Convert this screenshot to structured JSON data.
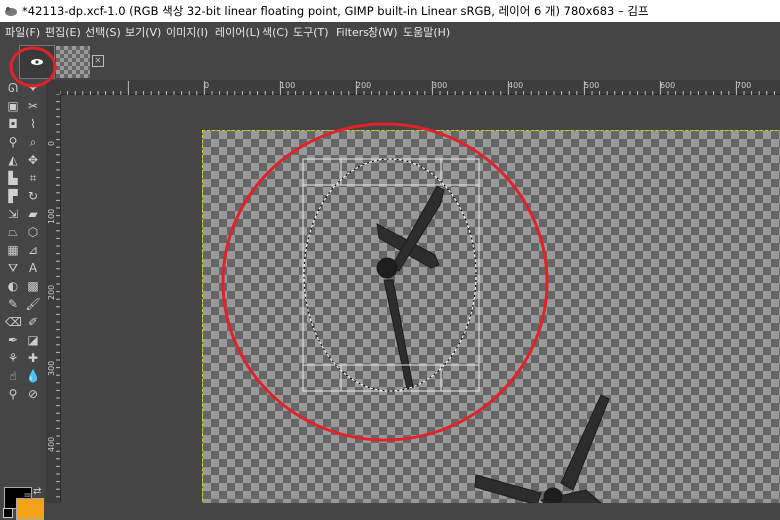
{
  "window": {
    "title": "*42113-dp.xcf-1.0 (RGB 색상 32-bit linear floating point, GIMP built-in Linear sRGB, 레이어 6 개) 780x683 – 김프"
  },
  "menu": {
    "items": [
      "파일(F)",
      "편집(E)",
      "선택(S)",
      "보기(V)",
      "이미지(I)",
      "레이어(L)",
      "색(C)",
      "도구(T)",
      "Filters",
      "창(W)",
      "도움말(H)"
    ]
  },
  "rulers": {
    "top_labels": [
      "0",
      "100",
      "200",
      "300",
      "400",
      "500",
      "600",
      "700"
    ],
    "left_labels": [
      "0",
      "100",
      "200",
      "300",
      "400"
    ]
  },
  "colors": {
    "foreground": "#000000",
    "background": "#f5a21b",
    "annotation": "#e0232b",
    "selection_border": "#d6d600"
  },
  "tools": [
    "lasso-icon",
    "fuzzy-select-icon",
    "scissors-icon",
    "crop-icon",
    "rotate-icon",
    "move-icon",
    "text-icon",
    "paint-icon",
    "eraser-icon",
    "blur-icon",
    "dodge-icon",
    "heal-icon"
  ]
}
